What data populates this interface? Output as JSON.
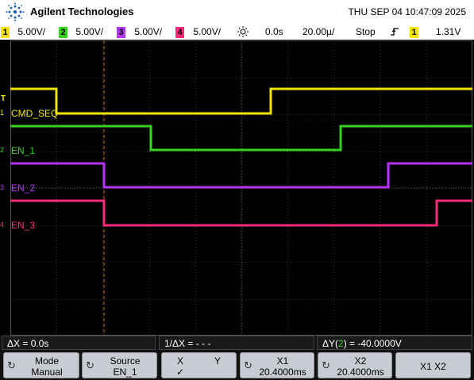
{
  "header": {
    "brand": "Agilent Technologies",
    "datetime": "THU SEP 04 10:47:09 2025"
  },
  "status_bar": {
    "ch1": {
      "num": "1",
      "scale": "5.00V/",
      "color": "#f2e400"
    },
    "ch2": {
      "num": "2",
      "scale": "5.00V/",
      "color": "#33d41c"
    },
    "ch3": {
      "num": "3",
      "scale": "5.00V/",
      "color": "#b333ff"
    },
    "ch4": {
      "num": "4",
      "scale": "5.00V/",
      "color": "#ff2a7a"
    },
    "delay": "0.0s",
    "timebase": "20.00µ/",
    "run_state": "Stop",
    "trig_channel": "1",
    "trig_level": "1.31V"
  },
  "channels": [
    {
      "label": "CMD_SEQ",
      "num": "1",
      "color": "#f2e400"
    },
    {
      "label": "EN_1",
      "num": "2",
      "color": "#33d41c"
    },
    {
      "label": "EN_2",
      "num": "3",
      "color": "#b333ff"
    },
    {
      "label": "EN_3",
      "num": "4",
      "color": "#ff2a7a"
    }
  ],
  "markers": {
    "trigger": "T"
  },
  "measurements": {
    "dx": "ΔX = 0.0s",
    "inv_dx": "1/ΔX = - - -",
    "dy_prefix": "ΔY(",
    "dy_channel": "2",
    "dy_suffix": ") = -40.0000V"
  },
  "softkeys": {
    "mode": {
      "label": "Mode",
      "value": "Manual"
    },
    "source": {
      "label": "Source",
      "value": "EN_1"
    },
    "xy": {
      "x": "X",
      "y": "Y",
      "check": "✓"
    },
    "x1": {
      "label": "X1",
      "value": "20.4000ms"
    },
    "x2": {
      "label": "X2",
      "value": "20.4000ms"
    },
    "x1x2": {
      "label": "X1 X2"
    }
  }
}
